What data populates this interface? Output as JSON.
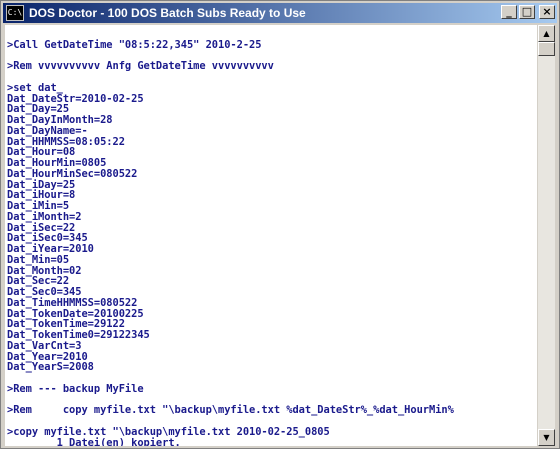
{
  "window": {
    "icon_text": "C:\\",
    "title": "DOS Doctor - 100 DOS Batch Subs Ready to Use",
    "minimize_glyph": "_",
    "maximize_glyph": "□",
    "close_glyph": "×"
  },
  "console": {
    "lines": [
      "",
      ">Call GetDateTime \"08:5:22,345\" 2010-2-25",
      "",
      ">Rem vvvvvvvvvv Anfg GetDateTime vvvvvvvvvv",
      "",
      ">set dat_",
      "Dat_DateStr=2010-02-25",
      "Dat_Day=25",
      "Dat_DayInMonth=28",
      "Dat_DayName=-",
      "Dat_HHMMSS=08:05:22",
      "Dat_Hour=08",
      "Dat_HourMin=0805",
      "Dat_HourMinSec=080522",
      "Dat_iDay=25",
      "Dat_iHour=8",
      "Dat_iMin=5",
      "Dat_iMonth=2",
      "Dat_iSec=22",
      "Dat_iSec0=345",
      "Dat_iYear=2010",
      "Dat_Min=05",
      "Dat_Month=02",
      "Dat_Sec=22",
      "Dat_Sec0=345",
      "Dat_TimeHHMMSS=080522",
      "Dat_TokenDate=20100225",
      "Dat_TokenTime=29122",
      "Dat_TokenTime0=29122345",
      "Dat_VarCnt=3",
      "Dat_Year=2010",
      "Dat_YearS=2008",
      "",
      ">Rem --- backup MyFile",
      "",
      ">Rem     copy myfile.txt \"\\backup\\myfile.txt %dat_DateStr%_%dat_HourMin%",
      "",
      ">copy myfile.txt \"\\backup\\myfile.txt 2010-02-25_0805",
      "        1 Datei(en) kopiert.",
      ""
    ],
    "prompt": ">"
  },
  "scrollbar": {
    "up_glyph": "▲",
    "down_glyph": "▼"
  }
}
